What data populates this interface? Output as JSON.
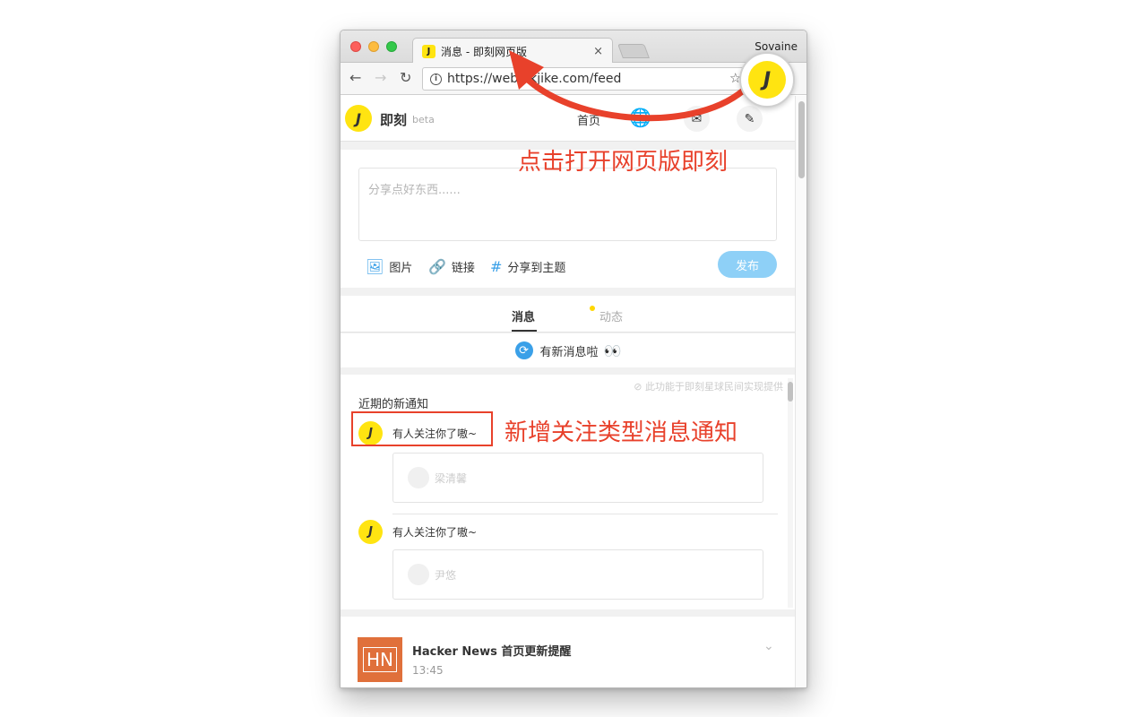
{
  "browser": {
    "tab_title": "消息 - 即刻网页版",
    "tab_favicon": "J",
    "tab_close": "×",
    "profile_name": "Sovaine",
    "url": "https://web.okjike.com/feed",
    "back": "←",
    "forward": "→",
    "reload": "↻",
    "star": "☆",
    "info": "i"
  },
  "header": {
    "logo_letter": "J",
    "brand": "即刻",
    "beta": "beta",
    "home": "首页",
    "message_icon": "✉",
    "compose_icon": "✎"
  },
  "composer": {
    "placeholder": "分享点好东西......",
    "tools": {
      "image": "图片",
      "link": "链接",
      "topic": "分享到主题"
    },
    "publish": "发布"
  },
  "panel_tabs": {
    "messages": "消息",
    "activity": "动态"
  },
  "new_messages_text": "有新消息啦",
  "new_messages_emoji": "👀",
  "notifications": {
    "heading": "近期的新通知",
    "provider": "⊘ 此功能于即刻星球民间实现提供",
    "items": [
      {
        "text": "有人关注你了嗷~",
        "avatar": "J",
        "card_user": "梁清馨"
      },
      {
        "text": "有人关注你了嗷~",
        "avatar": "J",
        "card_user": "尹悠"
      }
    ]
  },
  "hn_card": {
    "logo": "HN",
    "title": "Hacker News 首页更新提醒",
    "time": "13:45",
    "chevron": "⌄"
  },
  "annotations": {
    "open_web": "点击打开网页版即刻",
    "new_type": "新增关注类型消息通知"
  },
  "extension_icon_letter": "J",
  "colors": {
    "accent_yellow": "#ffe411",
    "link_blue": "#3aa0e8",
    "annotation_red": "#e8412b",
    "hn_orange": "#e0703b"
  }
}
